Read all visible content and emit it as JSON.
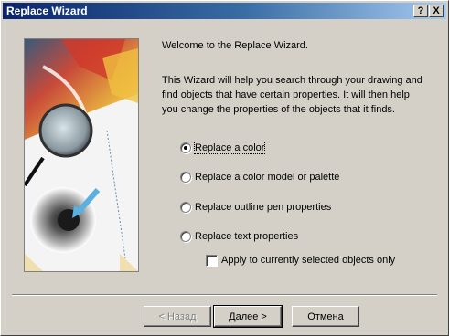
{
  "window": {
    "title": "Replace Wizard",
    "help_label": "?",
    "close_label": "X"
  },
  "content": {
    "welcome": "Welcome to the Replace Wizard.",
    "description": "This Wizard will help you search through your drawing and find objects that have certain properties. It will then help you change the properties of the objects that it finds."
  },
  "options": [
    {
      "label": "Replace a color",
      "checked": true
    },
    {
      "label": "Replace a color model or palette",
      "checked": false
    },
    {
      "label": "Replace outline pen properties",
      "checked": false
    },
    {
      "label": "Replace text properties",
      "checked": false
    }
  ],
  "checkbox": {
    "label": "Apply to currently selected objects only",
    "checked": false
  },
  "buttons": {
    "back": "< Назад",
    "next": "Далее >",
    "cancel": "Отмена"
  }
}
